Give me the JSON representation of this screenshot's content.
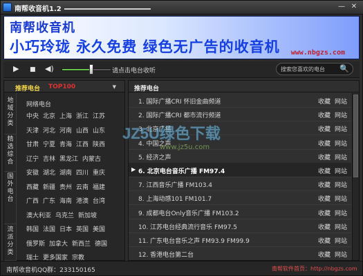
{
  "window": {
    "title": "南帮收音机1.2",
    "min_label": "—",
    "close_label": "✕"
  },
  "banner": {
    "line1": "南帮收音机",
    "line2": "小巧玲珑  永久免费  绿色无广告的收音机",
    "url": "www.nbgzs.com"
  },
  "controls": {
    "play_icon": "▶",
    "stop_icon": "■",
    "mute_icon": "◀)",
    "volume": 0.6,
    "hint": "请点击电台收听",
    "search_placeholder": "搜索您喜欢的电台",
    "search_icon": "🔍"
  },
  "left": {
    "tab_recommended": "推荐电台",
    "tab_top": "TOP100",
    "arrow": "▼",
    "vtabs": [
      "地域分类",
      "精选综合",
      "国外电台",
      "流派分类"
    ],
    "grid_title": "网络电台",
    "cities": [
      [
        "中央",
        "北京",
        "上海",
        "浙江",
        "江苏"
      ],
      [
        "天津",
        "河北",
        "河南",
        "山西",
        "山东"
      ],
      [
        "甘肃",
        "宁夏",
        "青海",
        "江西",
        "陕西"
      ],
      [
        "辽宁",
        "吉林",
        "黑龙江",
        "内蒙古"
      ],
      [
        "安徽",
        "湖北",
        "湖南",
        "四川",
        "重庆"
      ],
      [
        "西藏",
        "新疆",
        "贵州",
        "云南",
        "福建"
      ],
      [
        "广西",
        "广东",
        "海南",
        "港澳",
        "台湾"
      ],
      [
        "澳大利亚",
        "乌克兰",
        "新加坡"
      ],
      [
        "韩国",
        "法国",
        "日本",
        "英国",
        "美国"
      ],
      [
        "俄罗斯",
        "加拿大",
        "新西兰",
        "德国"
      ],
      [
        "瑞士",
        "更多国家",
        "宗教"
      ]
    ]
  },
  "right": {
    "title": "推荐电台",
    "fav_label": "收藏",
    "site_label": "网站",
    "play_mark": "▶",
    "stations": [
      {
        "name": "1. 国际广播CRI 怀旧金曲频道",
        "active": false
      },
      {
        "name": "2. 国际广播CRI 都市流行频道",
        "active": false
      },
      {
        "name": "3. 北京广播",
        "active": false
      },
      {
        "name": "4. 中国之声",
        "active": false
      },
      {
        "name": "5. 经济之声",
        "active": false
      },
      {
        "name": "6. 北京电台音乐广播 FM97.4",
        "active": true
      },
      {
        "name": "7. 江西音乐广播 FM103.4",
        "active": false
      },
      {
        "name": "8. 上海动感101 FM101.7",
        "active": false
      },
      {
        "name": "9. 成都电台Only音乐广播 FM103.2",
        "active": false
      },
      {
        "name": "10. 江苏电台经典流行音乐 FM97.5",
        "active": false
      },
      {
        "name": "11. 广东电台音乐之声 FM93.9 FM99.9",
        "active": false
      },
      {
        "name": "12. 香港电台第二台",
        "active": false
      }
    ]
  },
  "watermark": {
    "text": "JZ5U绿色下载",
    "sub": "www.jz5u.com"
  },
  "status": {
    "qq": "南帮收音机QQ群：233150165",
    "home": "南帮软件首页：http://nbgzs.com"
  }
}
